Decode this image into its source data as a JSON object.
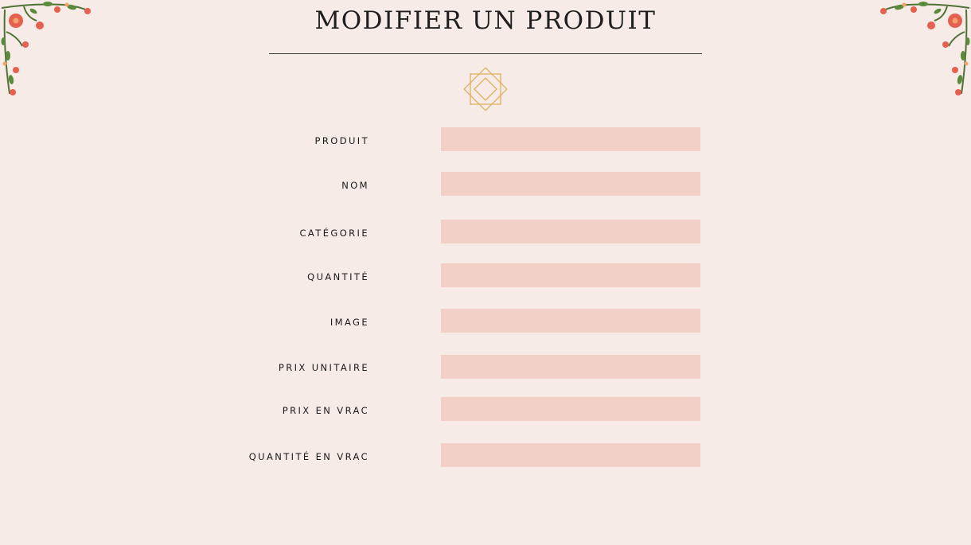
{
  "page": {
    "title": "MODIFIER UN PRODUIT"
  },
  "colors": {
    "background": "#f7ebe7",
    "input_fill": "#f2d0c7",
    "ornament_gold": "#e0b060",
    "flower_red": "#e5604f",
    "leaf_green": "#5a7a3a"
  },
  "icons": {
    "ornament": "star-octagon-ornament-icon",
    "corner_left": "floral-corner-icon",
    "corner_right": "floral-corner-icon"
  },
  "form": {
    "fields": [
      {
        "label": "PRODUIT",
        "value": ""
      },
      {
        "label": "NOM",
        "value": ""
      },
      {
        "label": "CATÉGORIE",
        "value": ""
      },
      {
        "label": "QUANTITÉ",
        "value": ""
      },
      {
        "label": "IMAGE",
        "value": ""
      },
      {
        "label": "PRIX UNITAIRE",
        "value": ""
      },
      {
        "label": "PRIX EN VRAC",
        "value": ""
      },
      {
        "label": "QUANTITÉ EN VRAC",
        "value": ""
      }
    ]
  }
}
